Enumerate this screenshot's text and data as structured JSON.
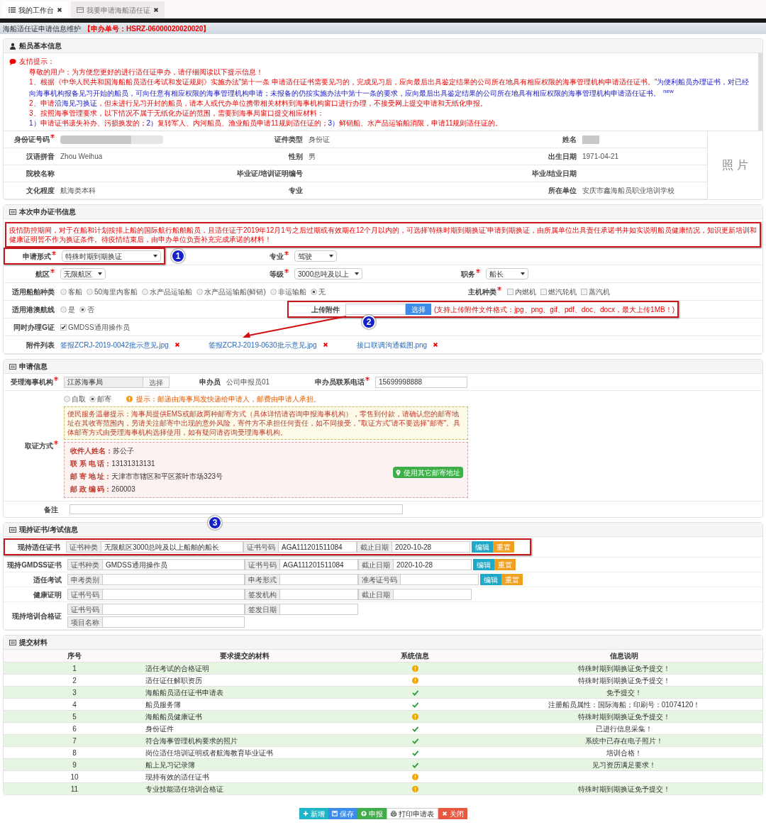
{
  "tabs": [
    {
      "label": "我的工作台",
      "selected": true
    },
    {
      "label": "我要申请海船适任证",
      "selected": false
    }
  ],
  "breadcrumb": {
    "title": "海船适任证申请信息维护",
    "order_no": "【申办单号：HSRZ-06000020020020】"
  },
  "basic": {
    "title": "船员基本信息",
    "notice_title": "友情提示：",
    "notice_lines": [
      {
        "parts": [
          {
            "kind": "normal",
            "text": "尊敬的用户：为方便您更好的进行适任证申办，请仔细阅读以下提示信息！"
          }
        ]
      },
      {
        "parts": [
          {
            "kind": "normal",
            "text": "1、根据《中华人民共和国海船船员适任考试和发证规则》实施办法\"第十一条 申请适任证书需要见习的，完成见习后，应向最后出具鉴定结果的公司所在地具有相应权限的海事管理机构申请适任证书。\""
          },
          {
            "kind": "emphasis",
            "text": "为便利船员办理证书，对已经向海事机构报备见习开始的船员，可向任意有相应权限的海事管理机构申请；未报备的仍按实施办法中第十一条的要求，应向最后出具鉴定结果的公司所在地具有相应权限的海事管理机构申请适任证书。"
          },
          {
            "kind": "superscript",
            "text": "new"
          }
        ]
      },
      {
        "parts": [
          {
            "kind": "normal",
            "text": "2、申请"
          },
          {
            "kind": "emphasis",
            "text": "沿海见习换证"
          },
          {
            "kind": "normal",
            "text": "，但未进行见习开封的船员，请本人或代办单位携带相关材料到海事机构窗口进行办理，不接受网上提交申请和无纸化申报。"
          }
        ]
      },
      {
        "parts": [
          {
            "kind": "normal",
            "text": "3、按照海事管理要求，以下情况不属于无纸化办证的范围，需要到海事局窗口提交相应材料："
          }
        ]
      },
      {
        "parts": [
          {
            "kind": "emphasis",
            "text": "1）"
          },
          {
            "kind": "normal",
            "text": "申请证书遗失补办、污损换发的；"
          },
          {
            "kind": "emphasis",
            "text": "2）"
          },
          {
            "kind": "normal",
            "text": "复转军人、内河船员、渔业船员申请11规则适任证的；"
          },
          {
            "kind": "emphasis",
            "text": "3）"
          },
          {
            "kind": "normal",
            "text": "鲜销船、水产品运输船消限，申请11规则适任证的。"
          }
        ]
      }
    ],
    "fields": [
      [
        {
          "label": "身份证号码",
          "required": true,
          "kind": "masked"
        },
        {
          "label": "证件类型",
          "required": false,
          "kind": "text",
          "value": "身份证"
        },
        {
          "label": "姓名",
          "required": false,
          "kind": "masked"
        }
      ],
      [
        {
          "label": "汉语拼音",
          "required": false,
          "kind": "text",
          "value": "Zhou Weihua"
        },
        {
          "label": "性别",
          "required": false,
          "kind": "text",
          "value": "男"
        },
        {
          "label": "出生日期",
          "required": false,
          "kind": "text",
          "value": "1971-04-21"
        }
      ],
      [
        {
          "label": "院校名称",
          "required": false,
          "kind": "text"
        },
        {
          "label": "毕业证/培训证明编号",
          "required": false,
          "kind": "text"
        },
        {
          "label": "毕业/结业日期",
          "required": false,
          "kind": "text"
        }
      ],
      [
        {
          "label": "文化程度",
          "required": false,
          "kind": "text",
          "value": "航海类本科"
        },
        {
          "label": "专业",
          "required": false,
          "kind": "text"
        },
        {
          "label": "所在单位",
          "required": false,
          "kind": "text",
          "value": "安庆市鑫海船员职业培训学校"
        }
      ]
    ],
    "photo": "照 片"
  },
  "cert": {
    "title": "本次申办证书信息",
    "alert": "疫情防控期间，对于在船和计划按排上船的国际航行船舶船员，且适任证于2019年12月1号之后过期或有效期在12个月以内的，可选择'特殊时期到期换证'申请到期换证，由所属单位出具责任承诺书并如实说明船员健康情况，知识更新培训和健康证明暂不作为换证条件。待疫情结束后，由申办单位负责补充完成承诺的材料！",
    "rows": [
      [
        {
          "label": "申请形式",
          "required": true,
          "kind": "select",
          "value": "特殊时期到期换证",
          "callout": "1"
        },
        {
          "label": "专业",
          "required": true,
          "kind": "select",
          "value": "驾驶"
        }
      ],
      [
        {
          "label": "航区",
          "required": true,
          "kind": "select",
          "value": "无限航区"
        },
        {
          "label": "等级",
          "required": true,
          "kind": "select",
          "value": "3000总吨及以上"
        },
        {
          "label": "职务",
          "required": true,
          "kind": "select",
          "value": "船长"
        }
      ],
      [
        {
          "label": "适用船舶种类",
          "required": false,
          "kind": "radios",
          "options": [
            {
              "label": "客船",
              "selected": false
            },
            {
              "label": "50海里内客船",
              "selected": false
            },
            {
              "label": "水产品运输船",
              "selected": false
            },
            {
              "label": "水产品运输船(鲜销)",
              "selected": false
            },
            {
              "label": "非运输船",
              "selected": false
            },
            {
              "label": "无",
              "selected": true
            }
          ]
        },
        {
          "label": "主机种类",
          "required": true,
          "kind": "checks",
          "options": [
            {
              "label": "内燃机",
              "checked": false
            },
            {
              "label": "燃汽轮机",
              "checked": false
            },
            {
              "label": "蒸汽机",
              "checked": false
            }
          ]
        }
      ],
      [
        {
          "label": "适用港澳航线",
          "required": false,
          "kind": "radios",
          "options": [
            {
              "label": "是",
              "selected": false
            },
            {
              "label": "否",
              "selected": true
            }
          ]
        },
        {
          "label": "上传附件",
          "required": false,
          "kind": "upload",
          "button": "选择",
          "hint": "(支持上传附件文件格式：jpg、png、gif、pdf、doc、docx，最大上传1MB！)",
          "callout": "2"
        }
      ],
      [
        {
          "label": "同时办理G证",
          "required": false,
          "kind": "checks",
          "options": [
            {
              "label": "GMDSS通用操作员",
              "checked": true
            }
          ]
        }
      ],
      [
        {
          "label": "附件列表",
          "required": false,
          "kind": "files",
          "files": [
            "签报ZCRJ-2019-0042批示意见.jpg",
            "签报ZCRJ-2019-0630批示意见.jpg",
            "接口联调沟通截图.png"
          ]
        }
      ]
    ]
  },
  "apply": {
    "title": "申请信息",
    "agency": {
      "label": "受理海事机构",
      "value": "江苏海事局",
      "button": "选择"
    },
    "agent": {
      "label": "申办员",
      "value": "公司申报员01"
    },
    "phone": {
      "label": "申办员联系电话",
      "value": "15699998888"
    },
    "pickup": {
      "label": "取证方式",
      "options": [
        {
          "label": "自取",
          "selected": false
        },
        {
          "label": "邮寄",
          "selected": true
        }
      ],
      "tip": "提示：邮递由海事局发快递给申请人，邮费由申请人承担。",
      "warning": "便民服务温馨提示：海事局提供EMS或邮政两种邮寄方式（具体详情请咨询申报海事机构），零售到付款，请确认您的邮寄地址在其收寄范围内，另请关注邮寄中出现的意外风险，寄件方不承担任何责任，如不同接受，\"取证方式\"请不要选择\"邮寄\"。具体邮寄方式由受理海事机构选择使用，如有疑问请咨询受理海事机构。",
      "address": [
        {
          "label": "收件人姓名：",
          "value": "苏公子"
        },
        {
          "label": "联 系 电 话：",
          "value": "13131313131"
        },
        {
          "label": "邮 寄 地 址：",
          "value": "天津市市辖区和平区茶叶市场323号"
        },
        {
          "label": "邮 政 编 码：",
          "value": "260003"
        }
      ],
      "other_button": "使用其它邮寄地址"
    },
    "remark": {
      "label": "备注"
    }
  },
  "held": {
    "title": "现持证书/考试信息",
    "callout": "3",
    "rows": [
      {
        "label": "现持适任证书",
        "highlight": true,
        "lines": [
          [
            {
              "label": "证书种类",
              "value": "无限航区3000总吨及以上船舶的船长"
            },
            {
              "label": "证书号码",
              "value": "AGA111201511084"
            },
            {
              "label": "截止日期",
              "value": "2020-10-28"
            }
          ]
        ],
        "buttons": [
          "编辑",
          "重置"
        ]
      },
      {
        "label": "现持GMDSS证书",
        "highlight": false,
        "lines": [
          [
            {
              "label": "证书种类",
              "value": "GMDSS通用操作员"
            },
            {
              "label": "证书号码",
              "value": "AGA111201511084"
            },
            {
              "label": "截止日期",
              "value": "2020-10-28"
            }
          ]
        ],
        "buttons": [
          "编辑",
          "重置"
        ]
      },
      {
        "label": "适任考试",
        "highlight": false,
        "lines": [
          [
            {
              "label": "申考类别"
            },
            {
              "label": "申考形式"
            },
            {
              "label": "准考证号码"
            }
          ]
        ],
        "buttons": [
          "编辑",
          "重置"
        ]
      },
      {
        "label": "健康证明",
        "highlight": false,
        "lines": [
          [
            {
              "label": "证书号码"
            },
            {
              "label": "签发机构"
            },
            {
              "label": "截止日期"
            }
          ]
        ]
      },
      {
        "label": "现持培训合格证",
        "highlight": false,
        "lines": [
          [
            {
              "label": "证书号码"
            },
            {
              "label": "签发日期"
            }
          ],
          [
            {
              "label": "项目名称"
            }
          ]
        ]
      }
    ]
  },
  "materials": {
    "title": "提交材料",
    "columns": [
      "序号",
      "要求提交的材料",
      "系统信息",
      "信息说明"
    ],
    "rows": [
      {
        "no": "1",
        "name": "适任考试的合格证明",
        "kind": "warning",
        "note": "特殊时期到期换证免予提交！"
      },
      {
        "no": "2",
        "name": "适任证任解职资历",
        "kind": "warning",
        "note": "特殊时期到期换证免予提交！"
      },
      {
        "no": "3",
        "name": "海船船员适任证书申请表",
        "kind": "check",
        "note": "免予提交！"
      },
      {
        "no": "4",
        "name": "船员服务簿",
        "kind": "check",
        "note": "注册船员属性：国际海船；印刷号：01074120！"
      },
      {
        "no": "5",
        "name": "海船船员健康证书",
        "kind": "warning",
        "note": "特殊时期到期换证免予提交！"
      },
      {
        "no": "6",
        "name": "身份证件",
        "kind": "check",
        "note": "已进行信息采集！"
      },
      {
        "no": "7",
        "name": "符合海事管理机构要求的照片",
        "kind": "check",
        "note": "系统中已存在电子照片！"
      },
      {
        "no": "8",
        "name": "岗位适任培训证明或者航海教育毕业证书",
        "kind": "check",
        "note": "培训合格！"
      },
      {
        "no": "9",
        "name": "船上见习记录簿",
        "kind": "check",
        "note": "见习资历满足要求！"
      },
      {
        "no": "10",
        "name": "现持有效的适任证书",
        "kind": "warning"
      },
      {
        "no": "11",
        "name": "专业技能适任培训合格证",
        "kind": "warning",
        "note": "特殊时期到期换证免予提交！"
      }
    ]
  },
  "actions": [
    {
      "kind": "add",
      "label": "新增"
    },
    {
      "kind": "save",
      "label": "保存"
    },
    {
      "kind": "submit",
      "label": "申报"
    },
    {
      "kind": "print",
      "label": "打印申请表"
    },
    {
      "kind": "close",
      "label": "关闭"
    }
  ]
}
